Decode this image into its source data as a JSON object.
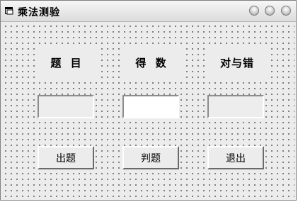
{
  "window": {
    "title": "乘法测验"
  },
  "labels": {
    "question": "题 目",
    "score": "得 数",
    "result": "对与错"
  },
  "fields": {
    "question_value": "",
    "score_value": "",
    "result_value": ""
  },
  "buttons": {
    "generate": "出题",
    "judge": "判题",
    "exit": "退出"
  }
}
